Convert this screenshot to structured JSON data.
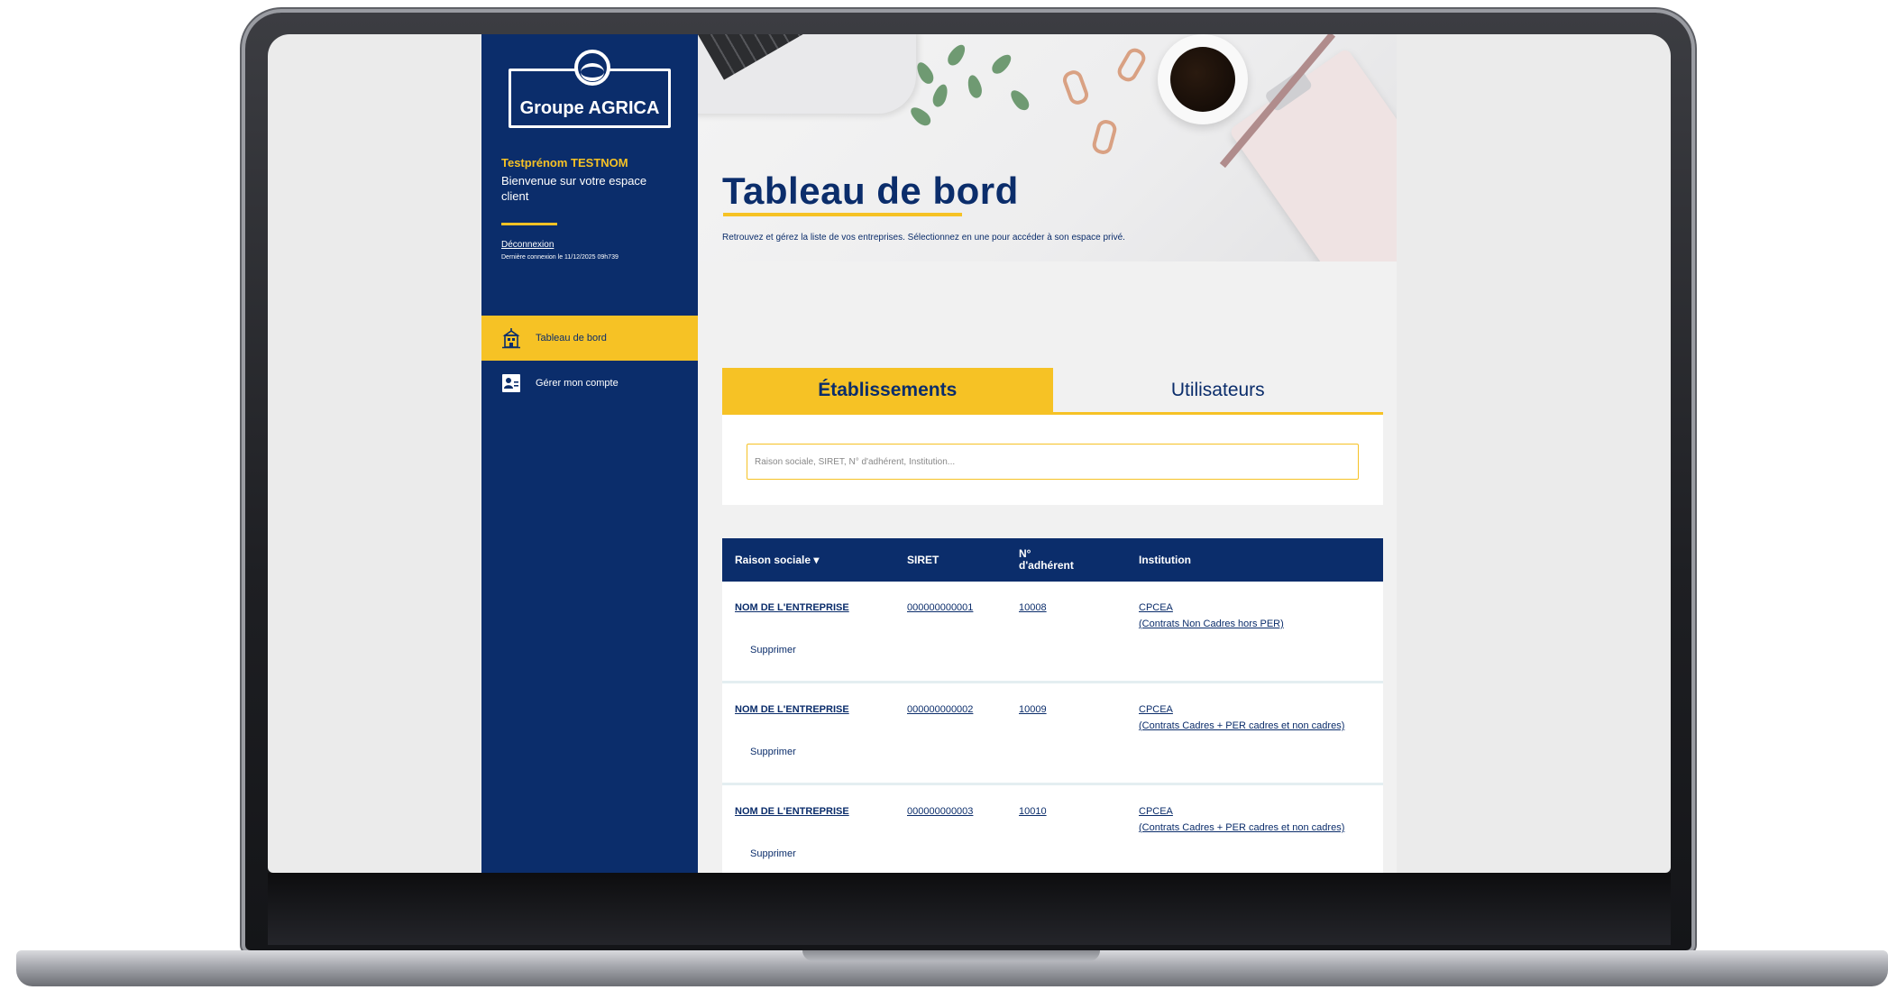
{
  "brand": {
    "logo_text": "Groupe AGRICA",
    "colors": {
      "navy": "#0b2d6b",
      "yellow": "#f6c225",
      "background": "#f1f1f1"
    }
  },
  "sidebar": {
    "user_name": "Testprénom TESTNOM",
    "welcome": "Bienvenue sur votre espace client",
    "logout_label": "Déconnexion",
    "last_login": "Dernière connexion le 11/12/2025 09h739",
    "nav": [
      {
        "label": "Tableau de bord",
        "icon": "building-icon",
        "active": true
      },
      {
        "label": "Gérer mon compte",
        "icon": "user-account-icon",
        "active": false
      }
    ]
  },
  "header": {
    "title": "Tableau de bord",
    "subtitle": "Retrouvez et gérez la liste de vos entreprises. Sélectionnez en une pour accéder à son espace privé."
  },
  "tabs": [
    {
      "label": "Établissements",
      "active": true
    },
    {
      "label": "Utilisateurs",
      "active": false
    }
  ],
  "search": {
    "placeholder": "Raison sociale, SIRET, N° d'adhérent, Institution...",
    "value": ""
  },
  "table": {
    "columns": {
      "company": "Raison sociale ▾",
      "siret": "SIRET",
      "member_line1": "N°",
      "member_line2": "d'adhérent",
      "institution": "Institution"
    },
    "rows": [
      {
        "company": "NOM DE L'ENTREPRISE",
        "siret": "000000000001",
        "member": "10008",
        "institution_name": "CPCEA",
        "institution_detail": "(Contrats Non Cadres hors PER)",
        "delete_label": "Supprimer"
      },
      {
        "company": "NOM DE L'ENTREPRISE",
        "siret": "000000000002",
        "member": "10009",
        "institution_name": "CPCEA",
        "institution_detail": "(Contrats Cadres + PER cadres et non cadres)",
        "delete_label": "Supprimer"
      },
      {
        "company": "NOM DE L'ENTREPRISE",
        "siret": "000000000003",
        "member": "10010",
        "institution_name": "CPCEA",
        "institution_detail": "(Contrats Cadres + PER cadres et non cadres)",
        "delete_label": "Supprimer"
      }
    ]
  }
}
